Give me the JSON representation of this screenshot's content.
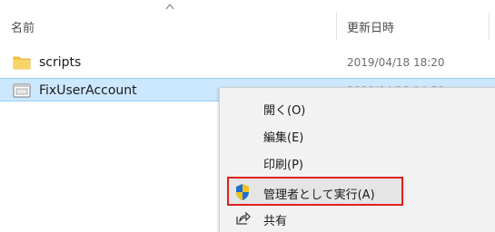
{
  "columns": {
    "name": "名前",
    "date_modified": "更新日時"
  },
  "files": [
    {
      "name": "scripts",
      "type": "folder",
      "date": "2019/04/18 18:20"
    },
    {
      "name": "FixUserAccount",
      "type": "script",
      "date": "2019/04/18 14:50",
      "selected": true
    }
  ],
  "context_menu": {
    "items": [
      {
        "label": "開く(O)"
      },
      {
        "label": "編集(E)"
      },
      {
        "label": "印刷(P)"
      },
      {
        "label": "管理者として実行(A)",
        "icon": "uac-shield-icon",
        "highlighted": true
      },
      {
        "label": "共有",
        "icon": "share-icon"
      }
    ]
  },
  "colors": {
    "selection_bg": "#cce8ff",
    "menu_bg": "#f2f2f2",
    "highlight_border": "#e0211b",
    "folder": "#f5c942"
  }
}
